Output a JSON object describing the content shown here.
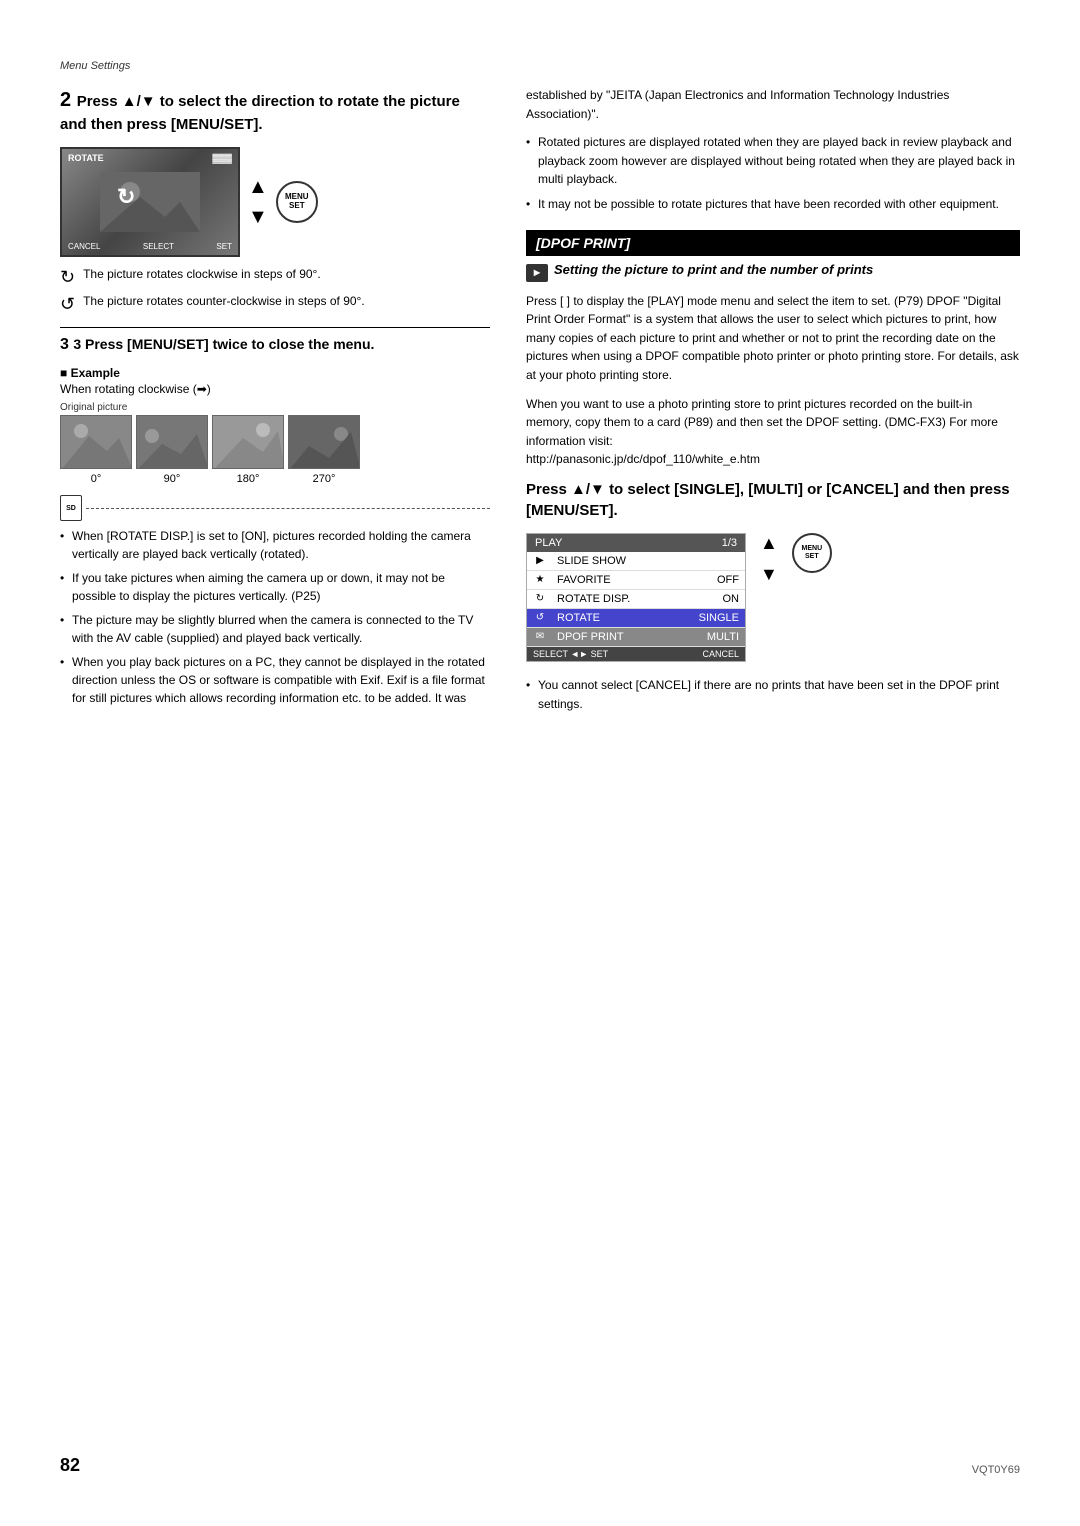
{
  "breadcrumb": "Menu Settings",
  "step2": {
    "heading": "2 Press ▲/▼ to select the direction to rotate the picture and then press [MENU/SET].",
    "heading_num": "2",
    "heading_text": "Press ▲/▼ to select the direction to rotate the picture and then press [MENU/SET].",
    "screen_label_top": "ROTATE",
    "screen_label_bottom_left": "CANCEL",
    "screen_label_bottom_mid": "SELECT",
    "screen_label_bottom_right": "SET",
    "note_cw": "The picture rotates clockwise in steps of 90°.",
    "note_ccw": "The picture rotates counter-clockwise in steps of 90°."
  },
  "step3": {
    "heading": "3 Press [MENU/SET] twice to close the menu."
  },
  "example": {
    "label": "■ Example",
    "when_rotating": "When rotating clockwise (➡)",
    "original_label": "Original picture",
    "rotation_labels": [
      "0°",
      "90°",
      "180°",
      "270°"
    ]
  },
  "left_bullets": [
    "When [ROTATE DISP.] is set to [ON], pictures recorded holding the camera vertically are played back vertically (rotated).",
    "If you take pictures when aiming the camera up or down, it may not be possible to display the pictures vertically. (P25)",
    "The picture may be slightly blurred when the camera is connected to the TV with the AV cable (supplied) and played back vertically.",
    "When you play back pictures on a PC, they cannot be displayed in the rotated direction unless the OS or software is compatible with Exif. Exif is a file format for still pictures which allows recording information etc. to be added. It was"
  ],
  "right_col": {
    "intro_text": "established by \"JEITA (Japan Electronics and Information Technology Industries Association)\".",
    "bullets": [
      "Rotated pictures are displayed rotated when they are played back in review playback and playback zoom however are displayed without being rotated when they are played back in multi playback.",
      "It may not be possible to rotate pictures that have been recorded with other equipment."
    ]
  },
  "dpof": {
    "title": "[DPOF PRINT]",
    "subheader": "Setting the picture to print and the number of prints",
    "body1": "Press [  ] to display the [PLAY] mode menu and select the item to set. (P79) DPOF \"Digital Print Order Format\" is a system that allows the user to select which pictures to print, how many copies of each picture to print and whether or not to print the recording date on the pictures when using a DPOF compatible photo printer or photo printing store. For details, ask at your photo printing store.",
    "body2": "When you want to use a photo printing store to print pictures recorded on the built-in memory, copy them to a card (P89) and then set the DPOF setting. (DMC-FX3) For more information visit:",
    "url": "http://panasonic.jp/dc/dpof_110/white_e.htm"
  },
  "press_select": {
    "heading": "Press ▲/▼ to select [SINGLE], [MULTI] or [CANCEL] and then press [MENU/SET]."
  },
  "play_menu": {
    "header_left": "PLAY",
    "header_right": "1/3",
    "rows": [
      {
        "icon": "▶",
        "label": "SLIDE SHOW",
        "value": ""
      },
      {
        "icon": "★",
        "label": "FAVORITE",
        "value": "OFF"
      },
      {
        "icon": "↻",
        "label": "ROTATE DISP.",
        "value": "ON"
      },
      {
        "icon": "↺",
        "label": "ROTATE",
        "value": "SINGLE"
      },
      {
        "icon": "✉",
        "label": "DPOF PRINT",
        "value": "MULTI"
      }
    ],
    "bottom_left": "SELECT ◄► SET",
    "bottom_right": "CANCEL",
    "selected_row": 3,
    "highlight_row": 4
  },
  "cannot_cancel_note": "You cannot select [CANCEL] if there are no prints that have been set in the DPOF print settings.",
  "footer": {
    "page_number": "82",
    "model": "VQT0Y69"
  }
}
